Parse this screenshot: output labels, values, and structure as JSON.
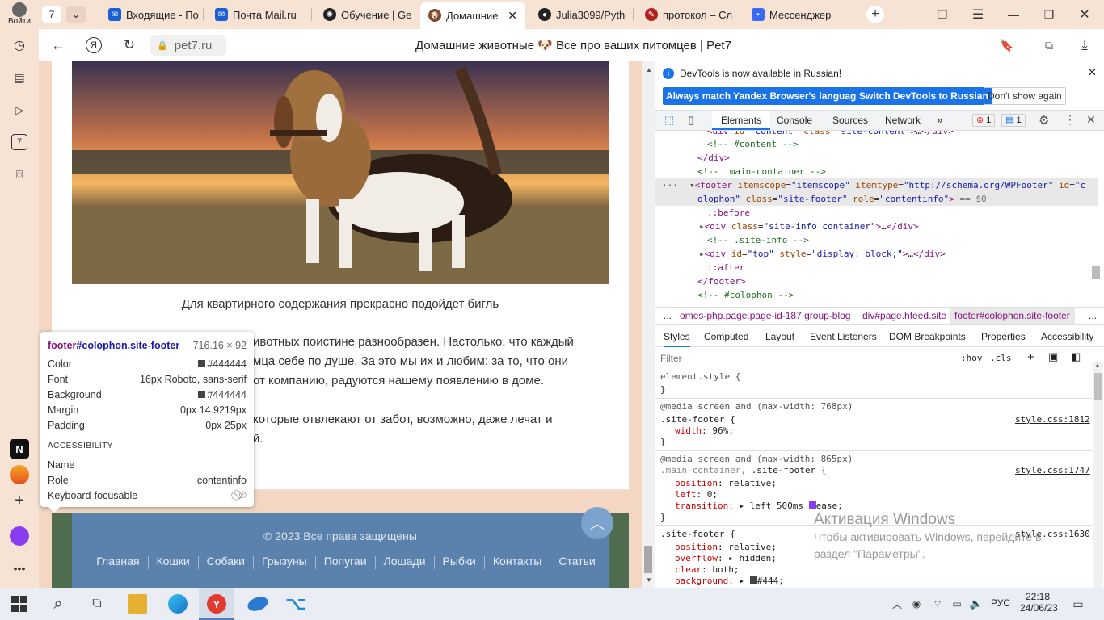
{
  "browser": {
    "account_label": "Войти",
    "tab_counter": "7",
    "tabs": [
      {
        "title": "Входящие - По",
        "icon": "mail-icon",
        "color": "#1a5fd6"
      },
      {
        "title": "Почта Mail.ru",
        "icon": "mail-icon",
        "color": "#1a5fd6"
      },
      {
        "title": "Обучение | Ge",
        "icon": "geekbrains-icon",
        "color": "#222222"
      },
      {
        "title": "Домашние",
        "icon": "pet-icon",
        "color": "#7a4a2a",
        "active": true
      },
      {
        "title": "Julia3099/Pyth",
        "icon": "github-icon",
        "color": "#222222"
      },
      {
        "title": "протокол – Сл",
        "icon": "dict-icon",
        "color": "#b32020"
      },
      {
        "title": "Мессенджер",
        "icon": "messenger-icon",
        "color": "#3a6bf5"
      }
    ],
    "url": "pet7.ru",
    "page_title": "Домашние животные 🐶 Все про ваших питомцев | Pet7"
  },
  "page": {
    "caption": "Для квартирного содержания прекрасно подойдет бигль",
    "p1": [
      "ивотных поистине разнообразен. Настолько, что каждый",
      "мца себе по душе. За это мы их и любим: за то, что они",
      "от компанию, радуются нашему появлению в доме."
    ],
    "p2": "которые отвлекают от забот, возможно, даже лечат и",
    "p2b": "й.",
    "copyright": "© 2023 Все права защищены",
    "footer_links": [
      "Главная",
      "Кошки",
      "Собаки",
      "Грызуны",
      "Попугаи",
      "Лошади",
      "Рыбки",
      "Контакты",
      "Статьи"
    ]
  },
  "tooltip": {
    "selector_tag": "footer",
    "selector_rest": "#colophon.site-footer",
    "size": "716.16 × 92",
    "rows": [
      {
        "label": "Color",
        "value": "#444444",
        "swatch": "#444444"
      },
      {
        "label": "Font",
        "value": "16px Roboto, sans-serif"
      },
      {
        "label": "Background",
        "value": "#444444",
        "swatch": "#444444"
      },
      {
        "label": "Margin",
        "value": "0px 14.9219px"
      },
      {
        "label": "Padding",
        "value": "0px 25px"
      }
    ],
    "accessibility_heading": "ACCESSIBILITY",
    "a11y": [
      {
        "label": "Name",
        "value": ""
      },
      {
        "label": "Role",
        "value": "contentinfo"
      },
      {
        "label": "Keyboard-focusable",
        "value": "⃠"
      }
    ]
  },
  "devtools": {
    "notice": "DevTools is now available in Russian!",
    "btn_match": "Always match Yandex Browser's language",
    "btn_switch": "Switch DevTools to Russian",
    "btn_dismiss": "Don't show again",
    "tabs": [
      "Elements",
      "Console",
      "Sources",
      "Network"
    ],
    "errors": "1",
    "messages": "1",
    "crumbs": [
      "...",
      "omes-php.page.page-id-187.group-blog",
      "div#page.hfeed.site",
      "footer#colophon.site-footer",
      "..."
    ],
    "subtabs": [
      "Styles",
      "Computed",
      "Layout",
      "Event Listeners",
      "DOM Breakpoints",
      "Properties",
      "Accessibility"
    ],
    "filter_placeholder": "Filter",
    "hov": ":hov",
    "cls": ".cls",
    "links": {
      "l1": "style.css:1812",
      "l2": "style.css:1747",
      "l3": "style.css:1630"
    }
  },
  "windows": {
    "activate_title": "Активация Windows",
    "activate_text1": "Чтобы активировать Windows, перейдите в",
    "activate_text2": "раздел \"Параметры\".",
    "lang": "РУС",
    "time": "22:18",
    "date": "24/06/23"
  }
}
